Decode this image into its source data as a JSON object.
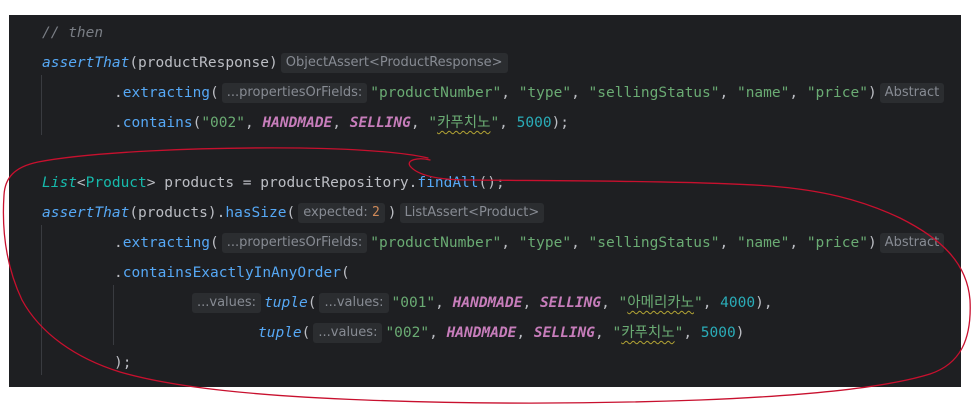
{
  "code": {
    "line1": {
      "comment": "// then"
    },
    "line2": {
      "method": "assertThat",
      "open": "(",
      "arg": "productResponse",
      "close": ")",
      "hint": "ObjectAssert<ProductResponse>"
    },
    "line3": {
      "dot": ".",
      "method": "extracting",
      "open": "(",
      "hint": "...propertiesOrFields:",
      "s1": "\"productNumber\"",
      "c1": ", ",
      "s2": "\"type\"",
      "c2": ", ",
      "s3": "\"sellingStatus\"",
      "c3": ", ",
      "s4": "\"name\"",
      "c4": ", ",
      "s5": "\"price\"",
      "close": ")",
      "trail_hint": "Abstract"
    },
    "line4": {
      "dot": ".",
      "method": "contains",
      "open": "(",
      "s1": "\"002\"",
      "c1": ", ",
      "k1": "HANDMADE",
      "c2": ", ",
      "k2": "SELLING",
      "c3": ", ",
      "q1": "\"",
      "ko": "카푸치노",
      "q2": "\"",
      "c4": ", ",
      "n1": "5000",
      "close": ");"
    },
    "line5": {
      "type": "List",
      "lt": "<",
      "generic": "Product",
      "gt": ">",
      "rest": " products = productRepository.",
      "method": "findAll",
      "close": "();"
    },
    "line6": {
      "method": "assertThat",
      "open": "(",
      "arg": "products",
      "mid": ").",
      "method2": "hasSize",
      "open2": "(",
      "hint_label": "expected:",
      "value": "2",
      "close": ")",
      "hint2": "ListAssert<Product>"
    },
    "line7": {
      "dot": ".",
      "method": "extracting",
      "open": "(",
      "hint": "...propertiesOrFields:",
      "s1": "\"productNumber\"",
      "c1": ", ",
      "s2": "\"type\"",
      "c2": ", ",
      "s3": "\"sellingStatus\"",
      "c3": ", ",
      "s4": "\"name\"",
      "c4": ", ",
      "s5": "\"price\"",
      "close": ")",
      "trail_hint": "Abstract"
    },
    "line8": {
      "dot": ".",
      "method": "containsExactlyInAnyOrder",
      "open": "("
    },
    "line9": {
      "hint1": "...values:",
      "method": "tuple",
      "open": "(",
      "hint2": "...values:",
      "s1": "\"001\"",
      "c1": ", ",
      "k1": "HANDMADE",
      "c2": ", ",
      "k2": "SELLING",
      "c3": ", ",
      "q1": "\"",
      "ko": "아메리카노",
      "q2": "\"",
      "c4": ", ",
      "n1": "4000",
      "close": "),"
    },
    "line10": {
      "method": "tuple",
      "open": "(",
      "hint": "...values:",
      "s1": "\"002\"",
      "c1": ", ",
      "k1": "HANDMADE",
      "c2": ", ",
      "k2": "SELLING",
      "c3": ", ",
      "q1": "\"",
      "ko": "카푸치노",
      "q2": "\"",
      "c4": ", ",
      "n1": "5000",
      "close": ")"
    },
    "line11": {
      "close": ");"
    }
  },
  "colors": {
    "background": "#1e1f22",
    "method": "#56a8f5",
    "string": "#6aab73",
    "number": "#2aacb8",
    "constant": "#c77dbb",
    "comment": "#7a7e85",
    "annotation": "#c8102e"
  }
}
